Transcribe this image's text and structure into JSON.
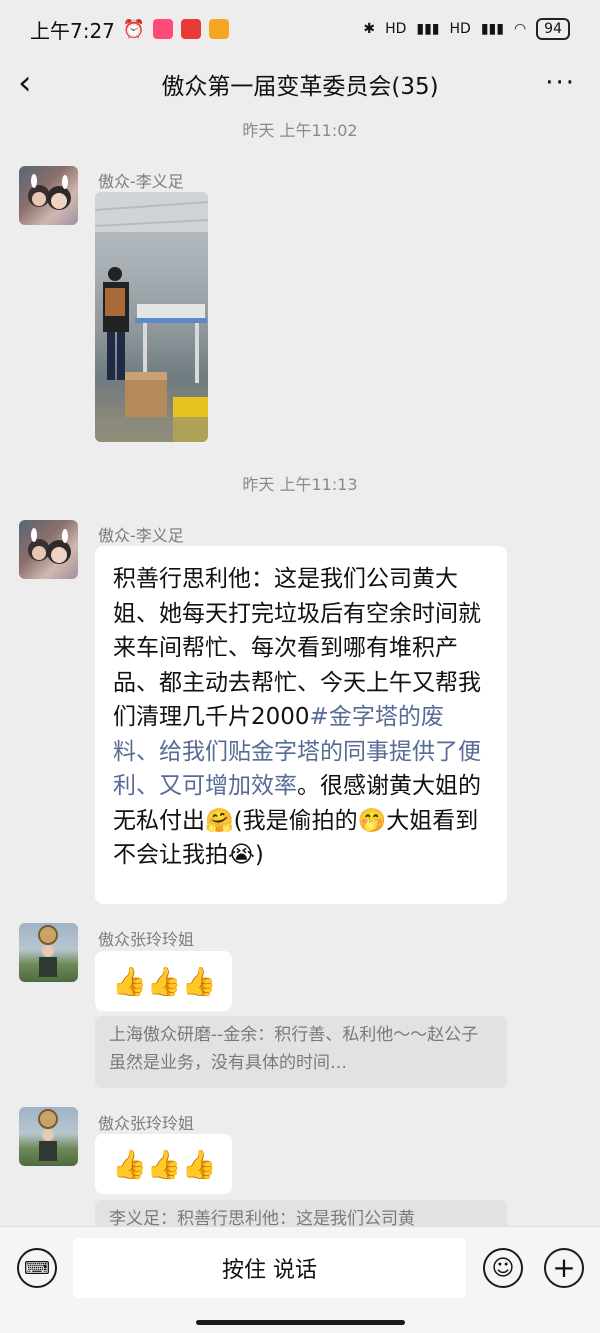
{
  "status_bar": {
    "time": "上午7:27",
    "alarm_icon": "alarm-icon",
    "app_icons": [
      "youku-app-icon",
      "toutiao-app-icon",
      "shop-app-icon"
    ],
    "signal1_label": "HD",
    "signal2_label": "HD",
    "battery": "94"
  },
  "nav": {
    "back_icon": "‹",
    "title": "傲众第一届变革委员会(35)",
    "more_icon": "···"
  },
  "messages": {
    "timestamp1": "昨天 上午11:02",
    "m1_sender": "傲众-李义足",
    "timestamp2": "昨天 上午11:13",
    "m2_sender": "傲众-李义足",
    "m2_text_plain": "积善行思利他：这是我们公司黄大姐、她每天打完垃圾后有空余时间就来车间帮忙、每次看到哪有堆积产品、都主动去帮忙、今天上午又帮我们清理几千片2000",
    "m2_text_link": "#金字塔的废料、给我们贴金字塔的同事提供了便利、又可增加效率",
    "m2_text_tail": "。很感谢黄大姐的无私付出🤗(我是偷拍的🤭大姐看到不会让我拍😭)",
    "m3_sender": "傲众张玲玲姐",
    "m3_text": "👍👍👍",
    "quote1": "上海傲众研磨--金余：积行善、私利他～～赵公子虽然是业务，没有具体的时间…",
    "m4_sender": "傲众张玲玲姐",
    "m4_text": "👍👍👍",
    "quote2": "李义足：积善行思利他：这是我们公司黄"
  },
  "input": {
    "voice_label": "按住 说话",
    "keyboard_icon": "⌨",
    "emoji_icon": "☺",
    "plus_icon": "+"
  }
}
